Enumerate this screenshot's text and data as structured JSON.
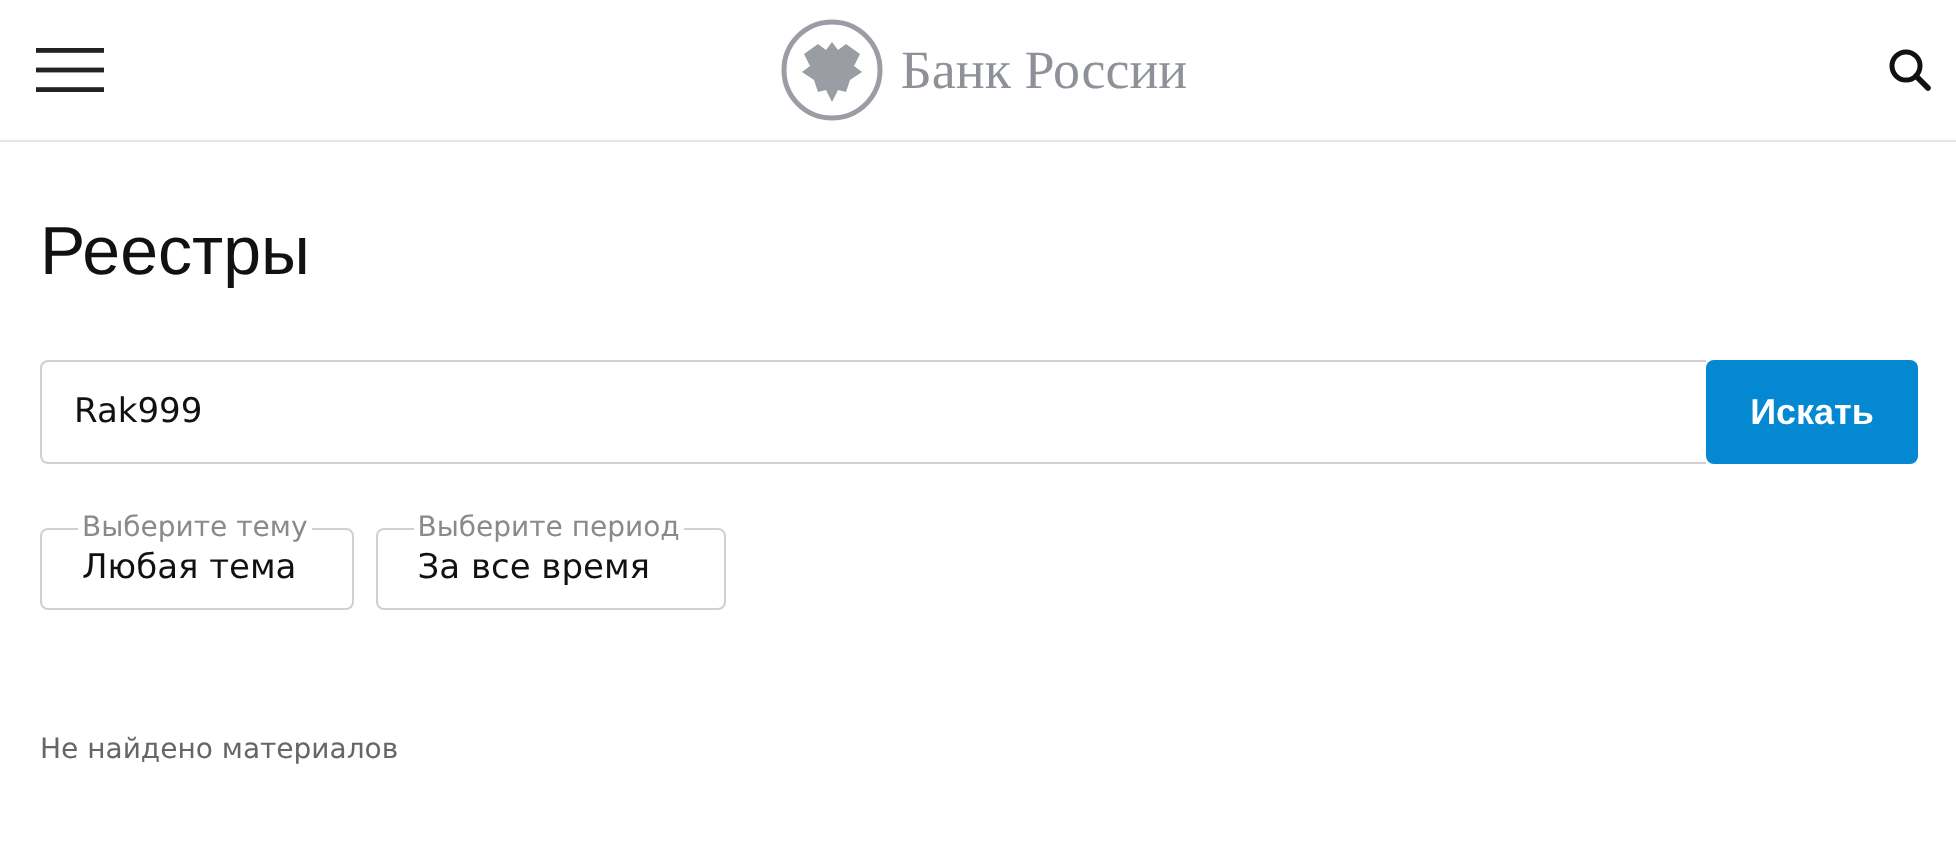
{
  "header": {
    "brand": "Банк России"
  },
  "title": "Реестры",
  "search": {
    "value": "Rak999",
    "button": "Искать"
  },
  "filters": [
    {
      "label": "Выберите тему",
      "value": "Любая тема"
    },
    {
      "label": "Выберите период",
      "value": "За все время"
    }
  ],
  "message": "Не найдено материалов"
}
